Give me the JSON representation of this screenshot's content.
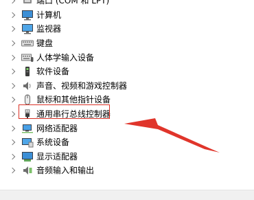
{
  "devices": [
    {
      "label": "端口 (COM 和 LPT)",
      "icon": "port-icon"
    },
    {
      "label": "计算机",
      "icon": "computer-icon"
    },
    {
      "label": "监视器",
      "icon": "monitor-icon"
    },
    {
      "label": "键盘",
      "icon": "keyboard-icon"
    },
    {
      "label": "人体学输入设备",
      "icon": "hid-icon"
    },
    {
      "label": "软件设备",
      "icon": "software-device-icon"
    },
    {
      "label": "声音、视频和游戏控制器",
      "icon": "speaker-icon"
    },
    {
      "label": "鼠标和其他指针设备",
      "icon": "mouse-icon"
    },
    {
      "label": "通用串行总线控制器",
      "icon": "usb-icon"
    },
    {
      "label": "网络适配器",
      "icon": "network-icon"
    },
    {
      "label": "系统设备",
      "icon": "system-device-icon"
    },
    {
      "label": "显示适配器",
      "icon": "display-adapter-icon"
    },
    {
      "label": "音频输入和输出",
      "icon": "audio-io-icon"
    }
  ],
  "highlight_color": "#d93025",
  "arrow_color": "#e0352b"
}
